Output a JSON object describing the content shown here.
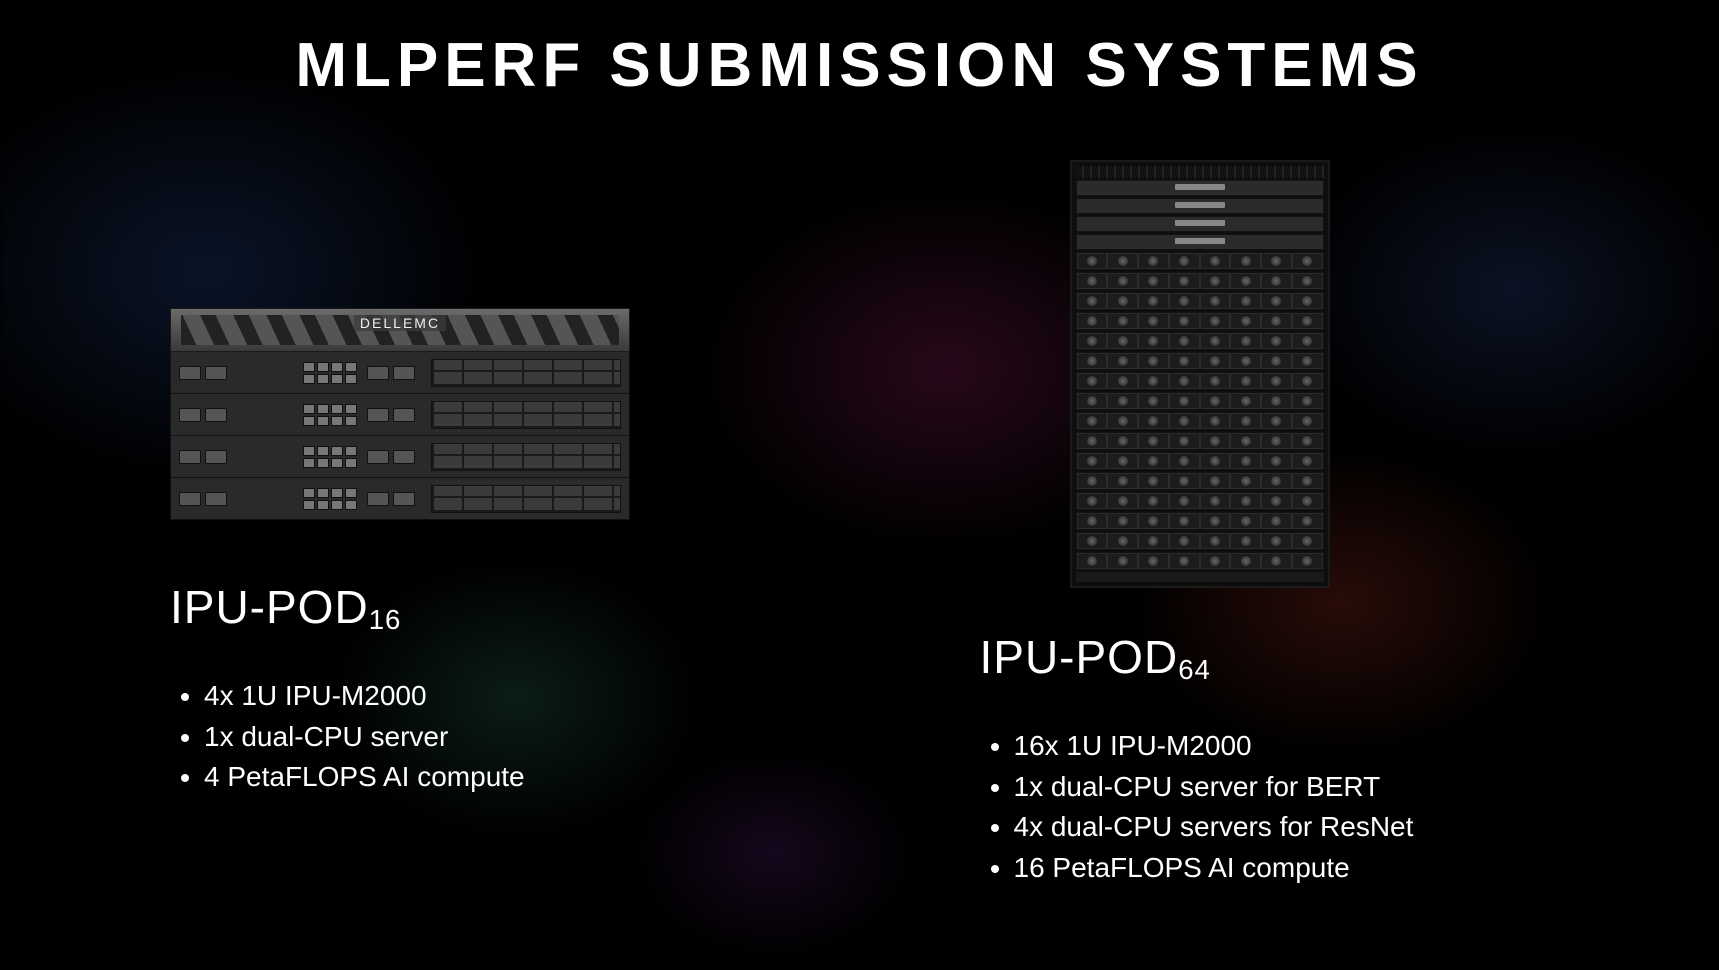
{
  "title": "MLPERF SUBMISSION SYSTEMS",
  "systems": [
    {
      "name_prefix": "IPU-POD",
      "name_sub": "16",
      "specs": [
        "4x 1U IPU-M2000",
        "1x dual-CPU server",
        "4 PetaFLOPS AI compute"
      ],
      "server_brand": "DELLEMC",
      "ipu_row_count": 4
    },
    {
      "name_prefix": "IPU-POD",
      "name_sub": "64",
      "specs": [
        "16x 1U IPU-M2000",
        "1x dual-CPU server for BERT",
        "4x dual-CPU servers for ResNet",
        "16 PetaFLOPS AI compute"
      ],
      "server_rows": 4,
      "fan_rows": 16,
      "fans_per_row": 8
    }
  ]
}
